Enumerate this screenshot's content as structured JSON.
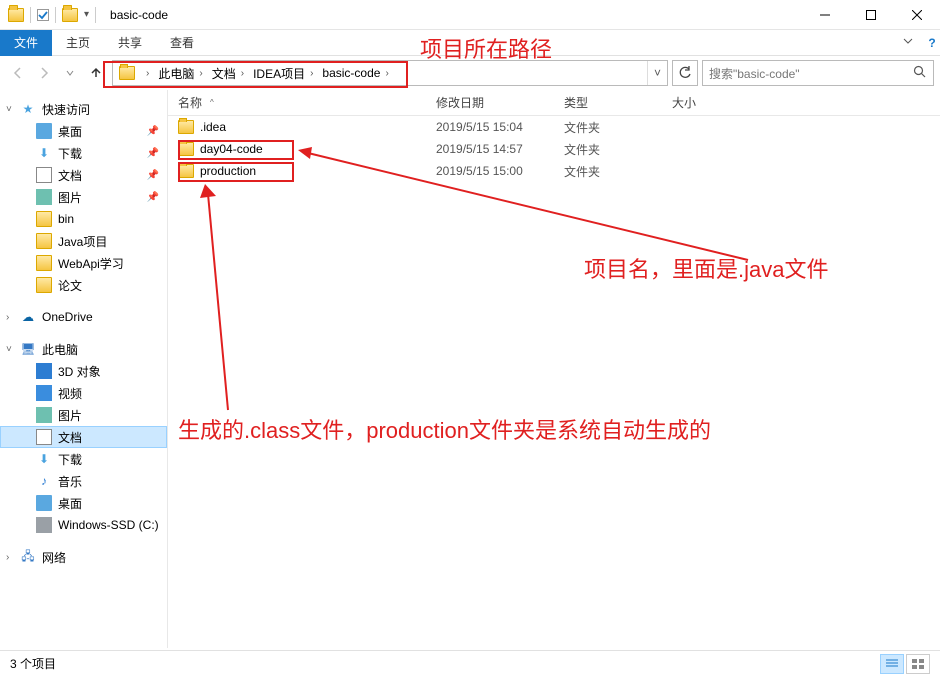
{
  "window": {
    "title": "basic-code"
  },
  "ribbon": {
    "file": "文件",
    "home": "主页",
    "share": "共享",
    "view": "查看"
  },
  "breadcrumb": [
    "此电脑",
    "文档",
    "IDEA项目",
    "basic-code"
  ],
  "search": {
    "placeholder": "搜索\"basic-code\""
  },
  "columns": {
    "name": "名称",
    "date": "修改日期",
    "type": "类型",
    "size": "大小"
  },
  "rows": [
    {
      "name": ".idea",
      "date": "2019/5/15 15:04",
      "type": "文件夹",
      "size": ""
    },
    {
      "name": "day04-code",
      "date": "2019/5/15 14:57",
      "type": "文件夹",
      "size": ""
    },
    {
      "name": "production",
      "date": "2019/5/15 15:00",
      "type": "文件夹",
      "size": ""
    }
  ],
  "sidebar": {
    "quick": {
      "label": "快速访问",
      "items": [
        "桌面",
        "下载",
        "文档",
        "图片",
        "bin",
        "Java项目",
        "WebApi学习",
        "论文"
      ]
    },
    "onedrive": "OneDrive",
    "thispc": {
      "label": "此电脑",
      "items": [
        "3D 对象",
        "视频",
        "图片",
        "文档",
        "下载",
        "音乐",
        "桌面",
        "Windows-SSD (C:)"
      ]
    },
    "network": "网络"
  },
  "status": {
    "count": "3 个项目"
  },
  "annotations": {
    "path": "项目所在路径",
    "projname": "项目名，里面是.java文件",
    "classgen": "生成的.class文件，production文件夹是系统自动生成的"
  }
}
